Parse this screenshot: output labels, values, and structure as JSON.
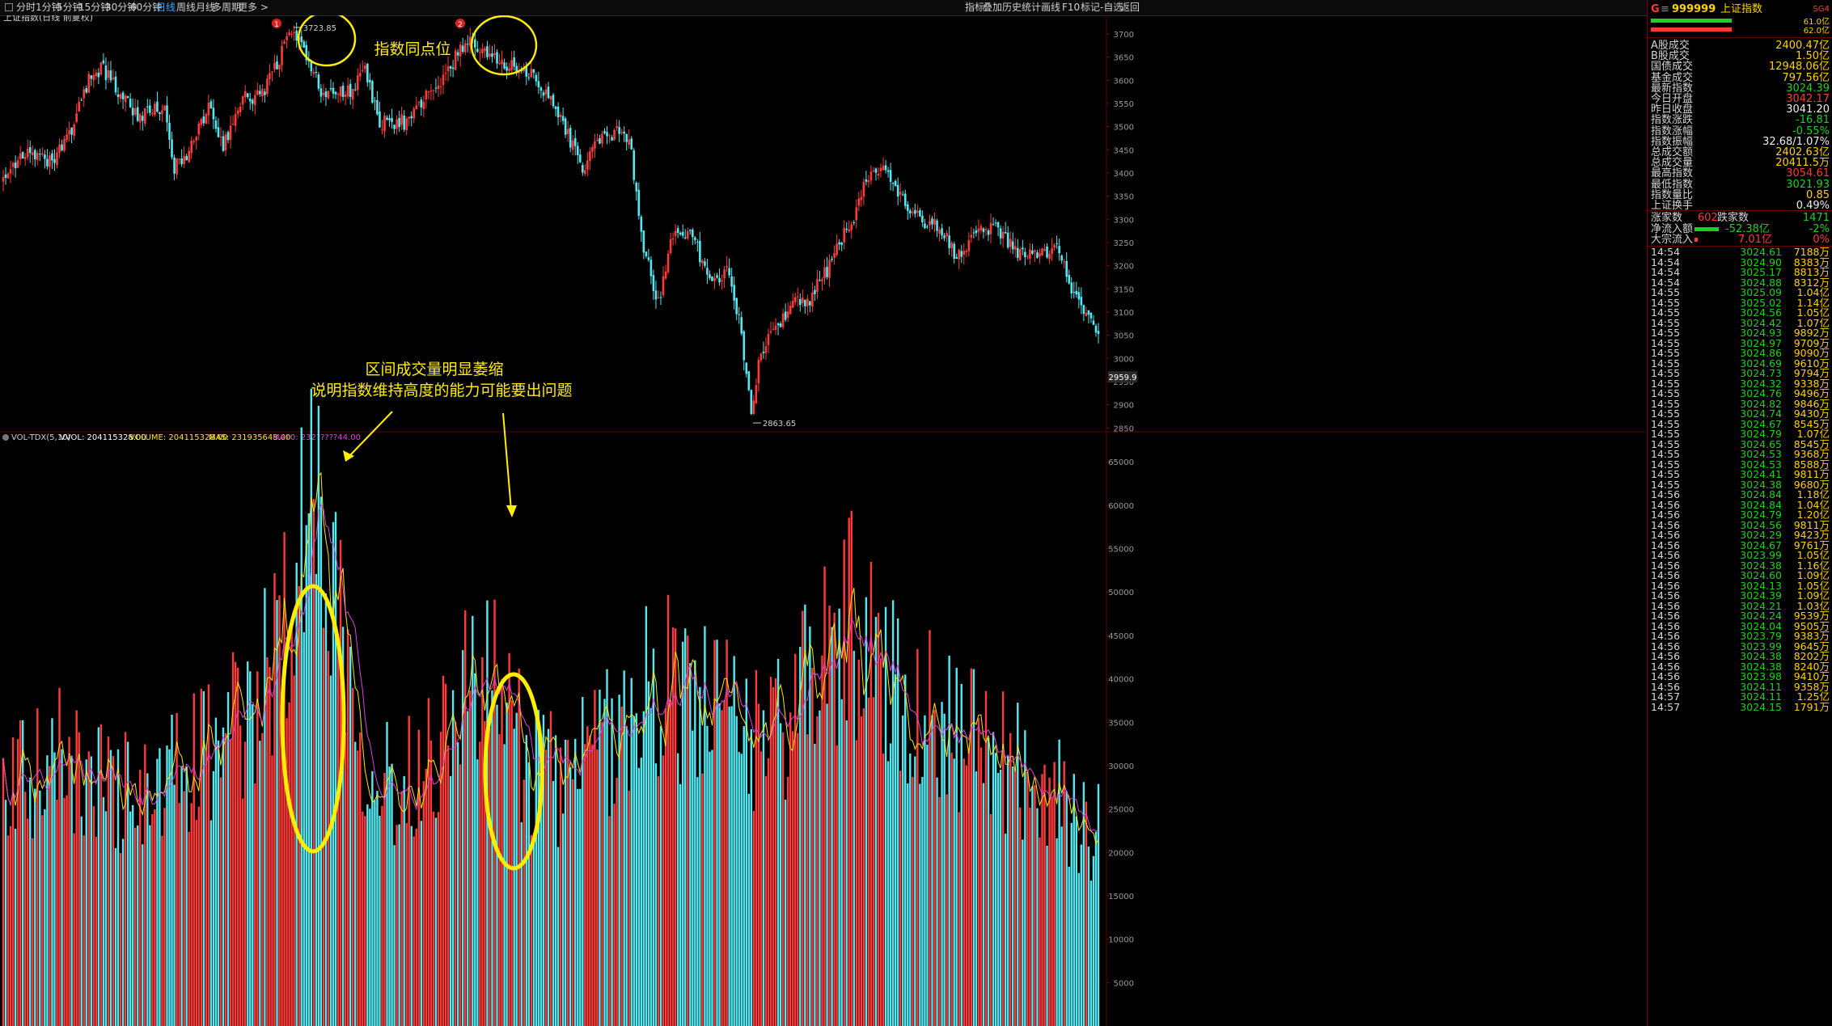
{
  "toolbar": {
    "periods": [
      "分时",
      "1分钟",
      "5分钟",
      "15分钟",
      "30分钟",
      "60分钟",
      "日线",
      "周线",
      "月线",
      "多周期",
      "更多 >"
    ],
    "active_period": "日线",
    "right_items": [
      "指标",
      "叠加",
      "历史",
      "统计",
      "画线",
      "F10",
      "标记",
      "-自选",
      "返回"
    ]
  },
  "chart_header": {
    "title": "上证指数(日线 前复权)",
    "vol_label": "VOL-TDX(5,10)",
    "vvol": "VVOL: 204115328.00",
    "volume": "VOLUME: 204115328.00",
    "ma5": "MA5: 231935648.00",
    "ma10": "MA10: 232?????44.00"
  },
  "annotations": {
    "top_text": "指数同点位",
    "bottom_text_1": "区间成交量明显萎缩",
    "bottom_text_2": "说明指数维持高度的能力可能要出问题",
    "marker_1": "1",
    "marker_2": "2",
    "high_label": "3723.85",
    "low_label": "2863.65",
    "last_label": "2959.9"
  },
  "price_axis": [
    "3700",
    "3650",
    "3600",
    "3550",
    "3500",
    "3450",
    "3400",
    "3350",
    "3300",
    "3250",
    "3200",
    "3150",
    "3100",
    "3050",
    "3000",
    "2950",
    "2900",
    "2850"
  ],
  "volume_axis": [
    "65000",
    "60000",
    "55000",
    "50000",
    "45000",
    "40000",
    "35000",
    "30000",
    "25000",
    "20000",
    "15000",
    "10000",
    "5000"
  ],
  "sidebar": {
    "code": "999999",
    "name": "上证指数",
    "badge": "G",
    "top_right": "SG4",
    "bar_value_1": "61.0亿",
    "bar_value_2": "62.0亿",
    "stats": [
      {
        "k": "A股成交",
        "v": "2400.47亿",
        "c": "yel"
      },
      {
        "k": "B股成交",
        "v": "1.50亿",
        "c": "yel"
      },
      {
        "k": "国债成交",
        "v": "12948.06亿",
        "c": "yel"
      },
      {
        "k": "基金成交",
        "v": "797.56亿",
        "c": "yel"
      },
      {
        "k": "最新指数",
        "v": "3024.39",
        "c": "grn"
      },
      {
        "k": "今日开盘",
        "v": "3042.17",
        "c": "red"
      },
      {
        "k": "昨日收盘",
        "v": "3041.20",
        "c": "wht"
      },
      {
        "k": "指数涨跌",
        "v": "-16.81",
        "c": "grn"
      },
      {
        "k": "指数涨幅",
        "v": "-0.55%",
        "c": "grn"
      },
      {
        "k": "指数振幅",
        "v": "32.68/1.07%",
        "c": "wht"
      },
      {
        "k": "总成交额",
        "v": "2402.63亿",
        "c": "yel"
      },
      {
        "k": "总成交量",
        "v": "20411.5万",
        "c": "yel"
      },
      {
        "k": "最高指数",
        "v": "3054.61",
        "c": "red"
      },
      {
        "k": "最低指数",
        "v": "3021.93",
        "c": "grn"
      },
      {
        "k": "指数量比",
        "v": "0.85",
        "c": "yel"
      },
      {
        "k": "上证换手",
        "v": "0.49%",
        "c": "wht"
      }
    ],
    "up_label": "涨家数",
    "up_count": "602",
    "down_label": "跌家数",
    "down_count": "1471",
    "net_inflow_label": "净流入额",
    "net_inflow_value": "-52.38亿",
    "net_inflow_pct": "-2%",
    "block_label": "大宗流入",
    "block_value": "7.01亿",
    "block_pct": "0%",
    "ticks": [
      [
        "14:54",
        "3024.61",
        "7188万"
      ],
      [
        "14:54",
        "3024.90",
        "8383万"
      ],
      [
        "14:54",
        "3025.17",
        "8813万"
      ],
      [
        "14:54",
        "3024.88",
        "8312万"
      ],
      [
        "14:55",
        "3025.09",
        "1.04亿"
      ],
      [
        "14:55",
        "3025.02",
        "1.14亿"
      ],
      [
        "14:55",
        "3024.56",
        "1.05亿"
      ],
      [
        "14:55",
        "3024.42",
        "1.07亿"
      ],
      [
        "14:55",
        "3024.93",
        "9892万"
      ],
      [
        "14:55",
        "3024.97",
        "9709万"
      ],
      [
        "14:55",
        "3024.86",
        "9090万"
      ],
      [
        "14:55",
        "3024.69",
        "9610万"
      ],
      [
        "14:55",
        "3024.73",
        "9794万"
      ],
      [
        "14:55",
        "3024.32",
        "9338万"
      ],
      [
        "14:55",
        "3024.76",
        "9496万"
      ],
      [
        "14:55",
        "3024.82",
        "9846万"
      ],
      [
        "14:55",
        "3024.74",
        "9430万"
      ],
      [
        "14:55",
        "3024.67",
        "8545万"
      ],
      [
        "14:55",
        "3024.79",
        "1.07亿"
      ],
      [
        "14:55",
        "3024.65",
        "8545万"
      ],
      [
        "14:55",
        "3024.53",
        "9368万"
      ],
      [
        "14:55",
        "3024.53",
        "8588万"
      ],
      [
        "14:55",
        "3024.41",
        "9811万"
      ],
      [
        "14:55",
        "3024.38",
        "9680万"
      ],
      [
        "14:56",
        "3024.84",
        "1.18亿"
      ],
      [
        "14:56",
        "3024.84",
        "1.04亿"
      ],
      [
        "14:56",
        "3024.79",
        "1.20亿"
      ],
      [
        "14:56",
        "3024.56",
        "9811万"
      ],
      [
        "14:56",
        "3024.29",
        "9423万"
      ],
      [
        "14:56",
        "3024.67",
        "9761万"
      ],
      [
        "14:56",
        "3023.99",
        "1.05亿"
      ],
      [
        "14:56",
        "3024.38",
        "1.16亿"
      ],
      [
        "14:56",
        "3024.60",
        "1.09亿"
      ],
      [
        "14:56",
        "3024.13",
        "1.05亿"
      ],
      [
        "14:56",
        "3024.39",
        "1.09亿"
      ],
      [
        "14:56",
        "3024.21",
        "1.03亿"
      ],
      [
        "14:56",
        "3024.24",
        "9539万"
      ],
      [
        "14:56",
        "3024.04",
        "9505万"
      ],
      [
        "14:56",
        "3023.79",
        "9383万"
      ],
      [
        "14:56",
        "3023.99",
        "9645万"
      ],
      [
        "14:56",
        "3024.38",
        "8202万"
      ],
      [
        "14:56",
        "3024.38",
        "8240万"
      ],
      [
        "14:56",
        "3023.98",
        "9410万"
      ],
      [
        "14:56",
        "3024.11",
        "9358万"
      ],
      [
        "14:57",
        "3024.11",
        "1.25亿"
      ],
      [
        "14:57",
        "3024.15",
        "1791万"
      ]
    ]
  },
  "colors": {
    "up": "#ff3a3a",
    "down": "#54e8f0",
    "ma5": "#ffe600",
    "ma10": "#e040e0",
    "annot": "#ffee00"
  },
  "chart_data": {
    "type": "candlestick",
    "title": "上证指数(日线 前复权)",
    "y_range": [
      2840,
      3740
    ],
    "volume_range": [
      0,
      68000
    ],
    "anchors": [
      [
        0,
        3400
      ],
      [
        8,
        3440
      ],
      [
        20,
        3420
      ],
      [
        28,
        3490
      ],
      [
        34,
        3590
      ],
      [
        40,
        3630
      ],
      [
        48,
        3570
      ],
      [
        56,
        3520
      ],
      [
        60,
        3535
      ],
      [
        66,
        3530
      ],
      [
        70,
        3410
      ],
      [
        76,
        3450
      ],
      [
        84,
        3540
      ],
      [
        90,
        3460
      ],
      [
        98,
        3560
      ],
      [
        106,
        3570
      ],
      [
        112,
        3640
      ],
      [
        118,
        3700
      ],
      [
        124,
        3660
      ],
      [
        130,
        3570
      ],
      [
        136,
        3570
      ],
      [
        142,
        3580
      ],
      [
        148,
        3620
      ],
      [
        154,
        3510
      ],
      [
        160,
        3510
      ],
      [
        166,
        3510
      ],
      [
        172,
        3560
      ],
      [
        178,
        3580
      ],
      [
        184,
        3640
      ],
      [
        190,
        3690
      ],
      [
        196,
        3660
      ],
      [
        202,
        3640
      ],
      [
        208,
        3630
      ],
      [
        214,
        3620
      ],
      [
        220,
        3590
      ],
      [
        226,
        3540
      ],
      [
        232,
        3470
      ],
      [
        238,
        3400
      ],
      [
        242,
        3480
      ],
      [
        248,
        3475
      ],
      [
        252,
        3490
      ],
      [
        256,
        3480
      ],
      [
        262,
        3240
      ],
      [
        268,
        3120
      ],
      [
        274,
        3270
      ],
      [
        282,
        3265
      ],
      [
        290,
        3150
      ],
      [
        296,
        3200
      ],
      [
        302,
        3060
      ],
      [
        306,
        2870
      ],
      [
        310,
        3020
      ],
      [
        316,
        3060
      ],
      [
        322,
        3120
      ],
      [
        330,
        3130
      ],
      [
        336,
        3180
      ],
      [
        342,
        3250
      ],
      [
        348,
        3300
      ],
      [
        354,
        3400
      ],
      [
        360,
        3415
      ],
      [
        366,
        3350
      ],
      [
        372,
        3310
      ],
      [
        378,
        3290
      ],
      [
        384,
        3280
      ],
      [
        390,
        3210
      ],
      [
        396,
        3260
      ],
      [
        402,
        3285
      ],
      [
        408,
        3270
      ],
      [
        414,
        3230
      ],
      [
        420,
        3220
      ],
      [
        426,
        3230
      ],
      [
        432,
        3240
      ],
      [
        438,
        3140
      ],
      [
        442,
        3100
      ],
      [
        448,
        3045
      ]
    ],
    "highlights": [
      3723.85,
      2863.65
    ],
    "vol_profile": [
      [
        0,
        26000
      ],
      [
        20,
        31000
      ],
      [
        40,
        28000
      ],
      [
        60,
        26000
      ],
      [
        80,
        31000
      ],
      [
        100,
        35000
      ],
      [
        110,
        42000
      ],
      [
        120,
        53000
      ],
      [
        126,
        60000
      ],
      [
        132,
        59000
      ],
      [
        138,
        48000
      ],
      [
        146,
        34000
      ],
      [
        160,
        27000
      ],
      [
        176,
        32000
      ],
      [
        190,
        40000
      ],
      [
        204,
        38000
      ],
      [
        214,
        30000
      ],
      [
        230,
        28000
      ],
      [
        250,
        34000
      ],
      [
        270,
        40000
      ],
      [
        290,
        36000
      ],
      [
        310,
        33000
      ],
      [
        330,
        39000
      ],
      [
        346,
        47000
      ],
      [
        360,
        41000
      ],
      [
        380,
        36000
      ],
      [
        400,
        32000
      ],
      [
        420,
        29000
      ],
      [
        440,
        24000
      ],
      [
        448,
        22000
      ]
    ]
  }
}
